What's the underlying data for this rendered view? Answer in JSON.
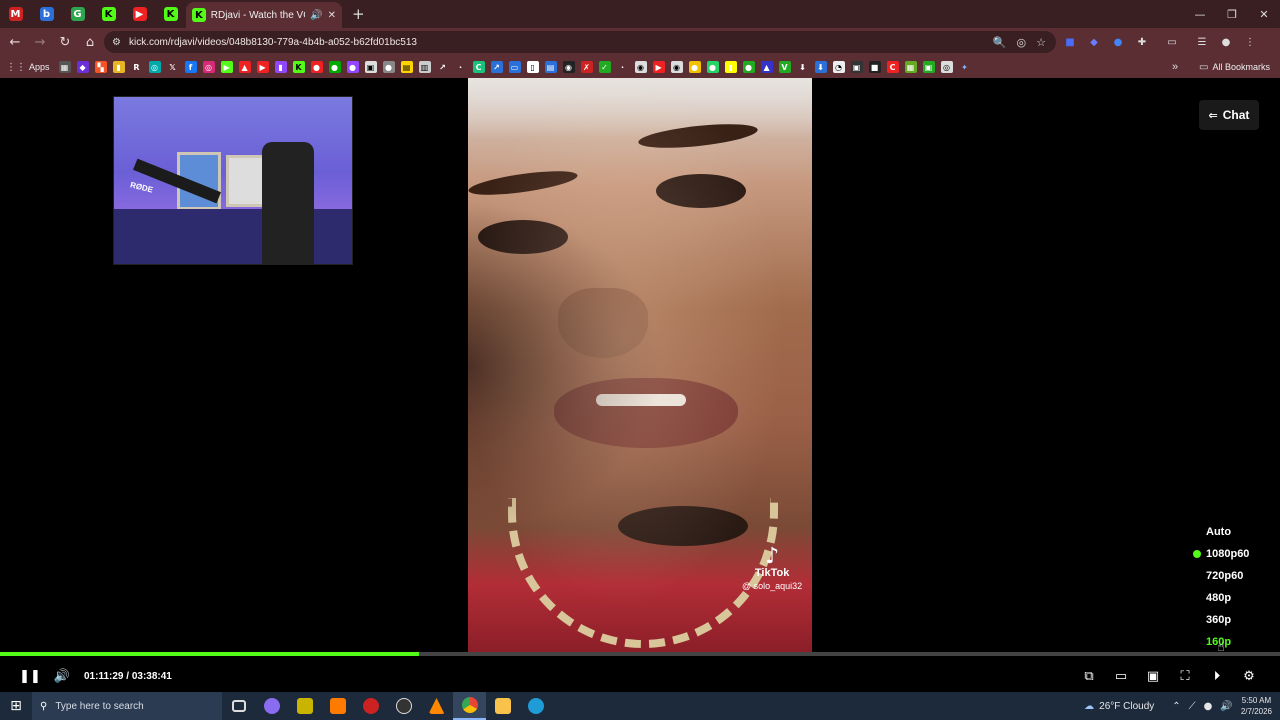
{
  "browser": {
    "active_tab_title": "RDjavi - Watch the VOD on",
    "url": "kick.com/rdjavi/videos/048b8130-779a-4b4b-a052-b62fd01bc513",
    "mini_tabs": [
      {
        "icon": "M",
        "color": "#c22"
      },
      {
        "icon": "b",
        "color": "#2b6fd8"
      },
      {
        "icon": "G",
        "color": "#2da44e"
      },
      {
        "icon": "K",
        "color": "#53fc18"
      },
      {
        "icon": "▶",
        "color": "#e22"
      },
      {
        "icon": "K",
        "color": "#53fc18"
      }
    ],
    "bookmarks_apps_label": "Apps",
    "all_bookmarks_label": "All Bookmarks"
  },
  "player": {
    "chat_label": "Chat",
    "current_time": "01:11:29",
    "duration": "03:38:41",
    "time_separator": "/",
    "progress_fraction": 0.327,
    "tiktok_label": "TikTok",
    "tiktok_handle": "@ solo_aqui32",
    "webcam_brand": "RØDE",
    "quality_options": [
      {
        "label": "Auto",
        "selected": false,
        "hover": false
      },
      {
        "label": "1080p60",
        "selected": true,
        "hover": false
      },
      {
        "label": "720p60",
        "selected": false,
        "hover": false
      },
      {
        "label": "480p",
        "selected": false,
        "hover": false
      },
      {
        "label": "360p",
        "selected": false,
        "hover": false
      },
      {
        "label": "160p",
        "selected": false,
        "hover": true
      }
    ],
    "accent_color": "#53fc18"
  },
  "taskbar": {
    "search_placeholder": "Type here to search",
    "weather": "26°F  Cloudy",
    "time": "5:50 AM",
    "date": "2/7/2026"
  }
}
